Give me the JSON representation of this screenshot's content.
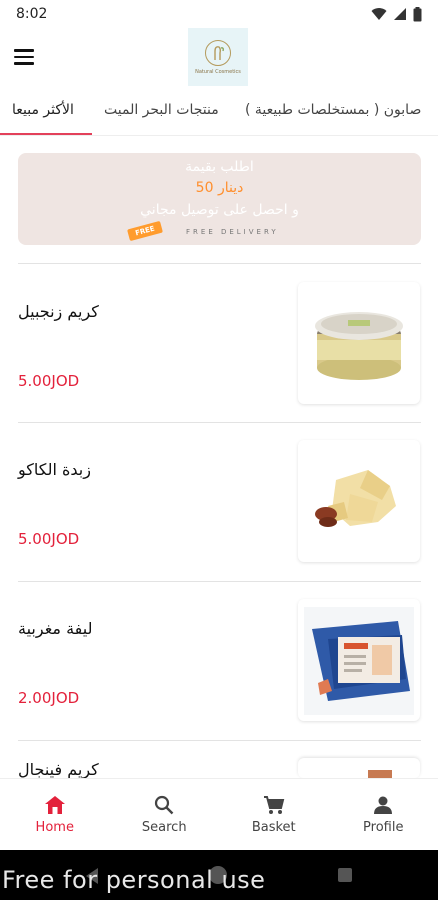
{
  "status": {
    "time": "8:02"
  },
  "tabs": [
    {
      "label": "صابون ( بمستخلصات طبيعية )",
      "active": false
    },
    {
      "label": "منتجات البحر الميت",
      "active": false
    },
    {
      "label": "الأكثر مبيعا",
      "active": true
    }
  ],
  "logo": {
    "text": "Natural Cosmetics"
  },
  "banner": {
    "line1": "اطلب بقيمة",
    "line2": "50 دينار",
    "line3": "و احصل على توصيل مجاني",
    "tag": "FREE",
    "delivery": "FREE DELIVERY"
  },
  "products": [
    {
      "name": "كريم زنجبيل",
      "price": "5.00JOD",
      "icon": "cream-jar-image"
    },
    {
      "name": "زبدة الكاكو",
      "price": "5.00JOD",
      "icon": "cocoa-butter-image"
    },
    {
      "name": "ليفة مغربية",
      "price": "2.00JOD",
      "icon": "moroccan-loofah-image"
    },
    {
      "name": "كريم فينجال",
      "price": "",
      "icon": "cream-jar-image"
    }
  ],
  "bottom_nav": [
    {
      "label": "Home",
      "icon": "home-icon",
      "active": true
    },
    {
      "label": "Search",
      "icon": "search-icon",
      "active": false
    },
    {
      "label": "Basket",
      "icon": "cart-icon",
      "active": false
    },
    {
      "label": "Profile",
      "icon": "profile-icon",
      "active": false
    }
  ],
  "watermark": "Free for personal use",
  "colors": {
    "accent": "#e3213b",
    "tab_indicator": "#e3405a",
    "banner_bg": "#efe5e2",
    "banner_highlight": "#ff8f2e"
  }
}
